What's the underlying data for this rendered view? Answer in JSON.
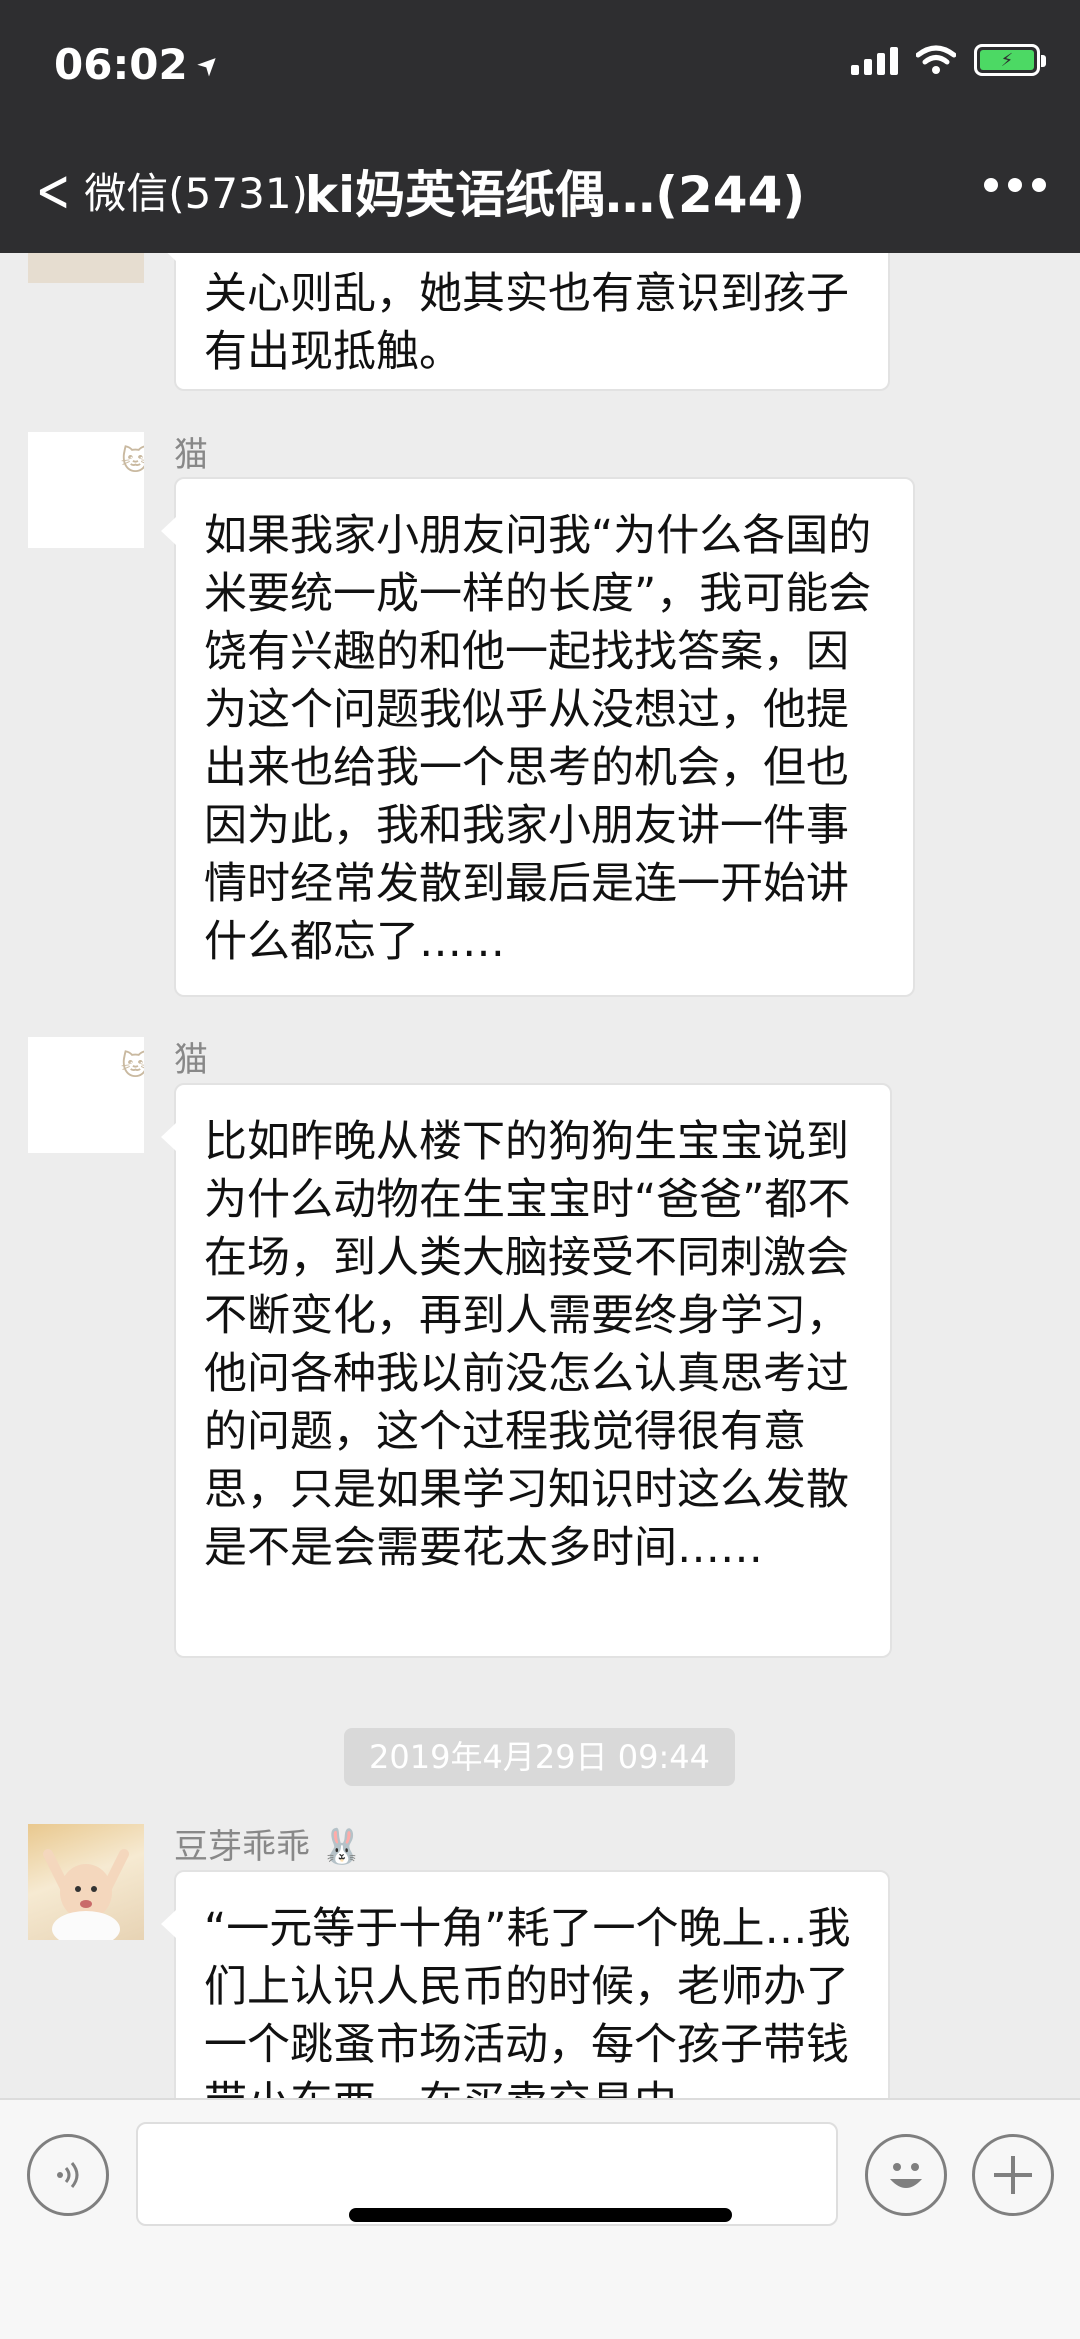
{
  "status_bar": {
    "time": "06:02",
    "location_arrow": "➤"
  },
  "nav": {
    "back_label": "微信(5731)",
    "title": "ki妈英语纸偶…(244)"
  },
  "messages": [
    {
      "sender": "",
      "text": "关心则乱，她其实也有意识到孩子有出现抵触。"
    },
    {
      "sender": "猫",
      "text": "如果我家小朋友问我“为什么各国的米要统一成一样的长度”，我可能会饶有兴趣的和他一起找找答案，因为这个问题我似乎从没想过，他提出来也给我一个思考的机会，但也因为此，我和我家小朋友讲一件事情时经常发散到最后是连一开始讲什么都忘了……"
    },
    {
      "sender": "猫",
      "text": "比如昨晚从楼下的狗狗生宝宝说到为什么动物在生宝宝时“爸爸”都不在场，到人类大脑接受不同刺激会不断变化，再到人需要终身学习，他问各种我以前没怎么认真思考过的问题，这个过程我觉得很有意思，只是如果学习知识时这么发散是不是会需要花太多时间……"
    },
    {
      "timestamp": "2019年4月29日 09:44"
    },
    {
      "sender": "豆芽乖乖 🐰",
      "text": "“一元等于十角”耗了一个晚上…我们上认识人民币的时候，老师办了一个跳蚤市场活动，每个孩子带钱带小东西，在买卖交易中"
    }
  ],
  "input": {
    "placeholder": ""
  },
  "icons": {
    "voice": "voice-icon",
    "emoji": "emoji-icon",
    "plus": "plus-icon"
  },
  "colors": {
    "nav_bg": "#2e2e30",
    "chat_bg": "#ededed",
    "battery": "#4cd964"
  }
}
